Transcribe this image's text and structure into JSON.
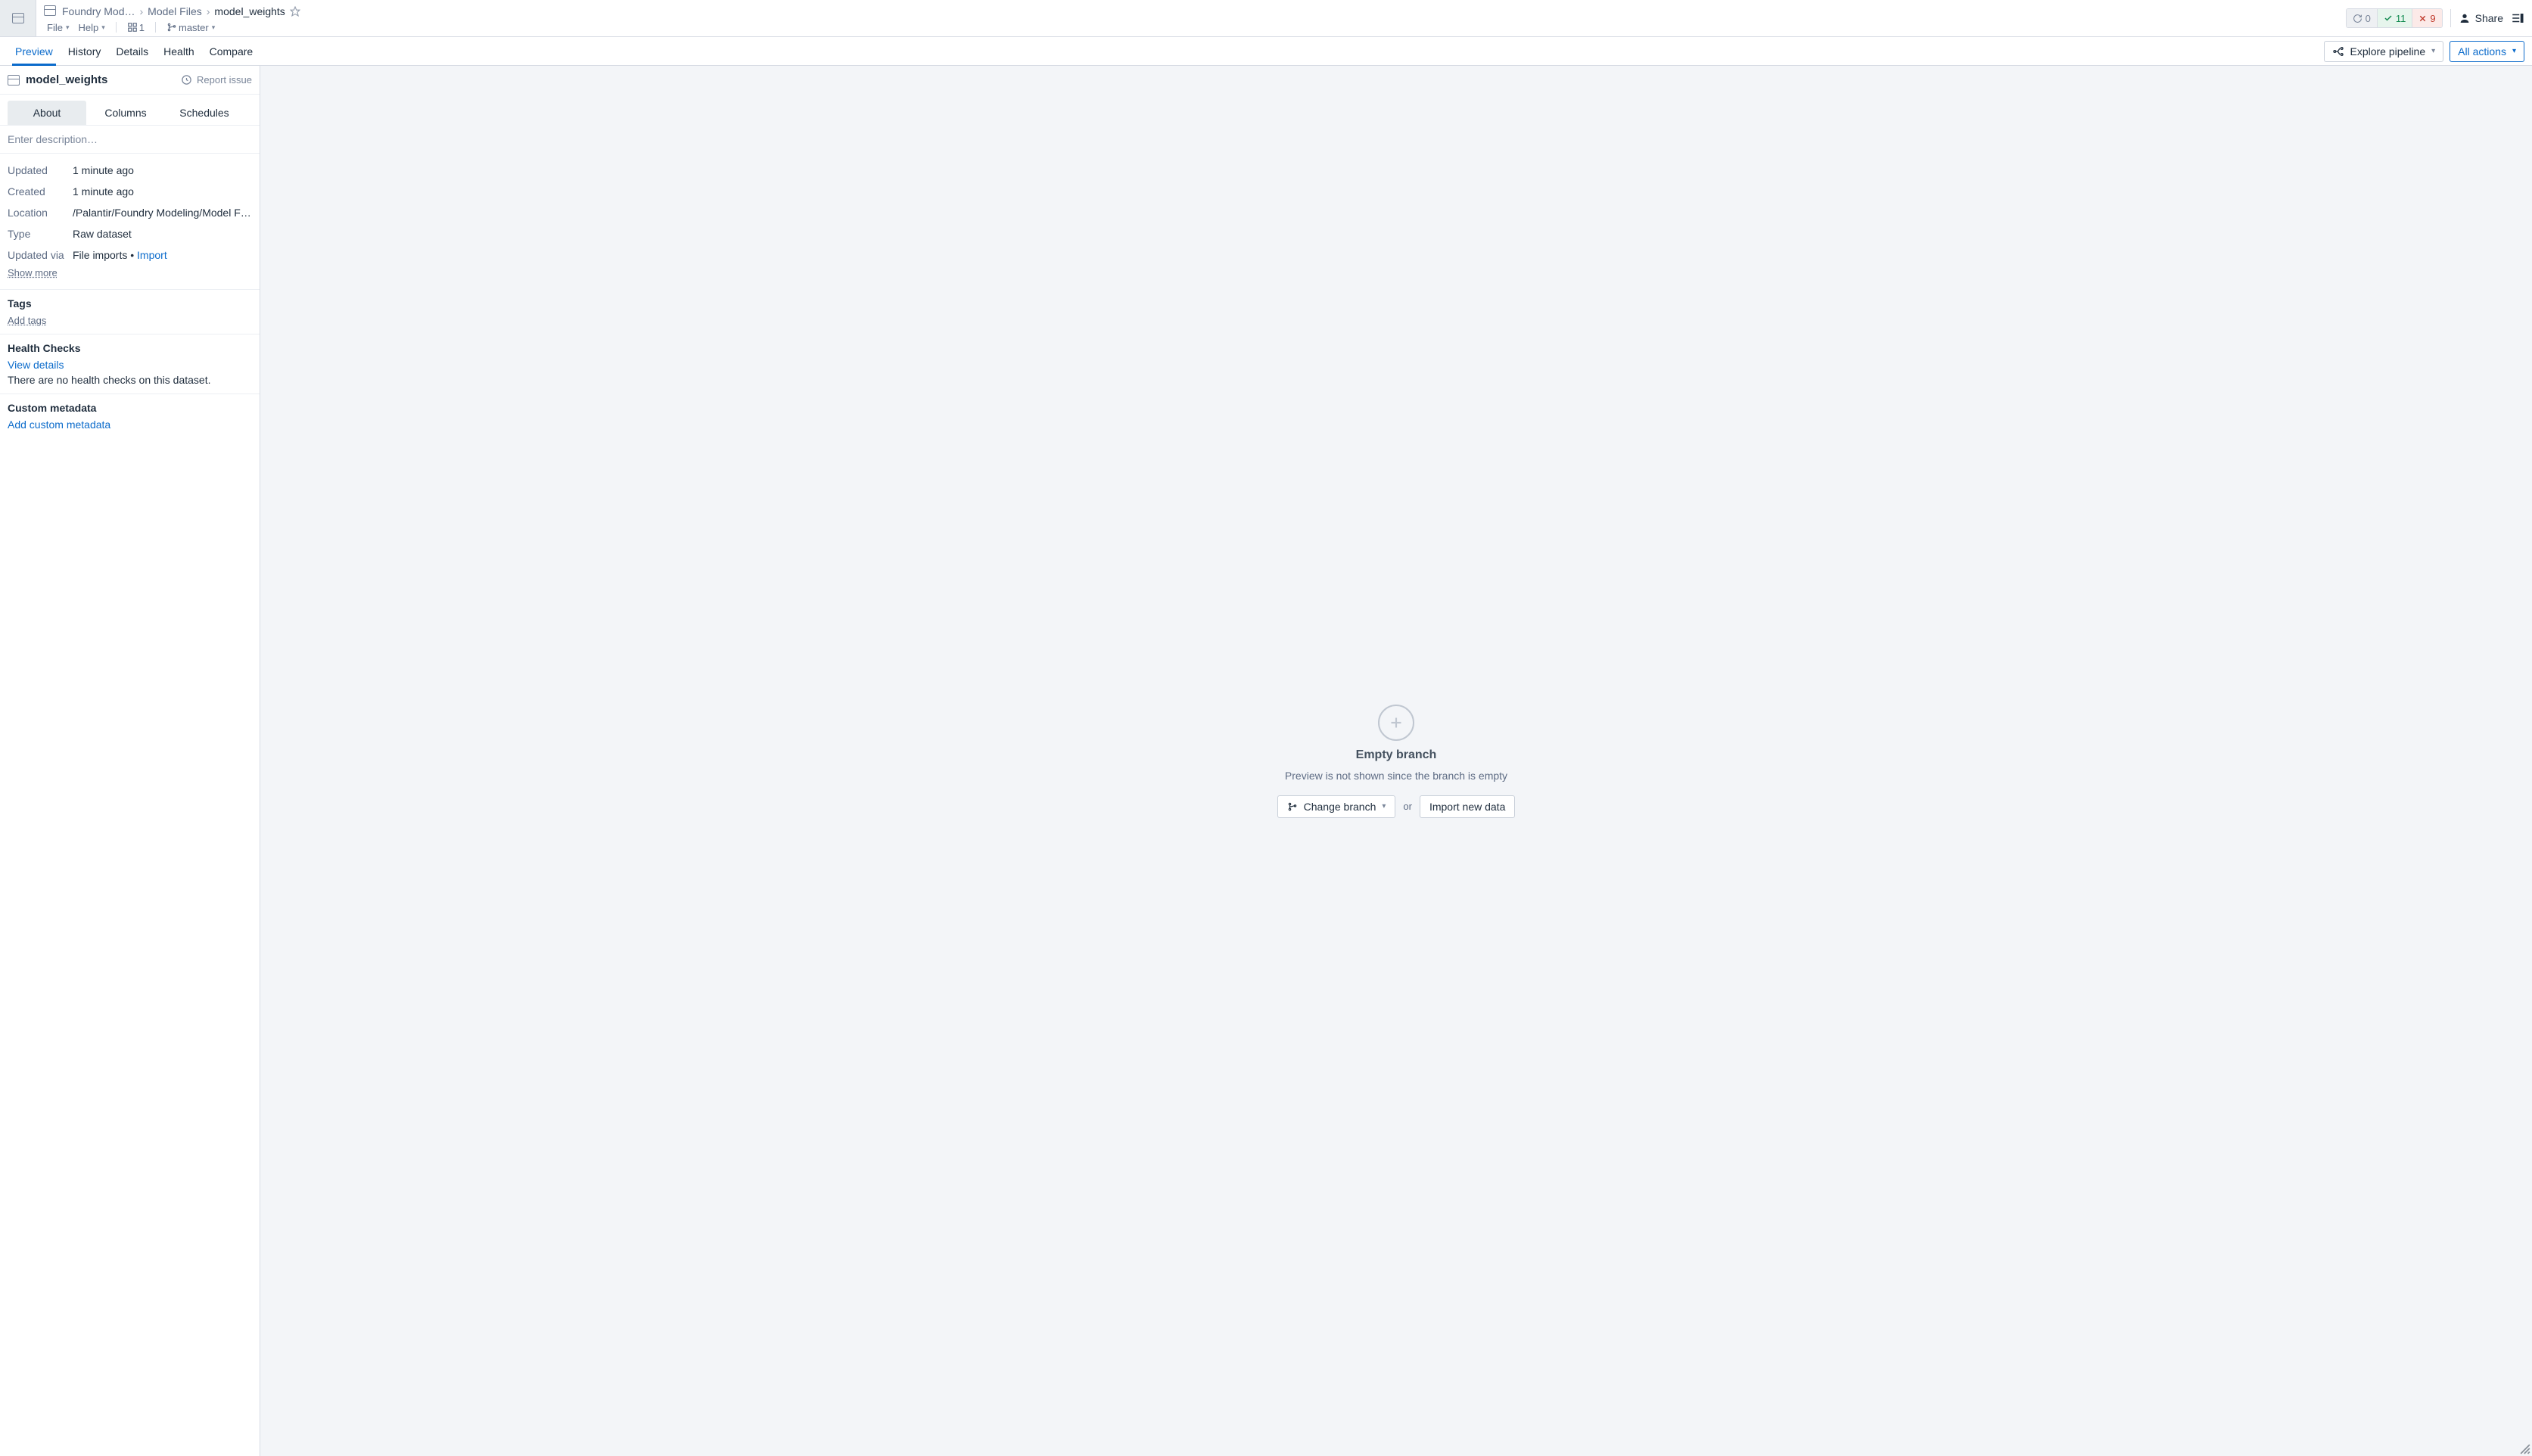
{
  "breadcrumb": {
    "items": [
      "Foundry Mod…",
      "Model Files",
      "model_weights"
    ]
  },
  "menubar": {
    "file": "File",
    "help": "Help",
    "view_count": "1",
    "branch": "master"
  },
  "status": {
    "sync": "0",
    "ok": "11",
    "err": "9"
  },
  "topbar": {
    "share": "Share"
  },
  "tabs": {
    "items": [
      "Preview",
      "History",
      "Details",
      "Health",
      "Compare"
    ],
    "explore_pipeline": "Explore pipeline",
    "all_actions": "All actions"
  },
  "sidebar": {
    "title": "model_weights",
    "report_issue": "Report issue",
    "subtabs": [
      "About",
      "Columns",
      "Schedules"
    ],
    "description_placeholder": "Enter description…",
    "meta": {
      "updated_k": "Updated",
      "updated_v": "1 minute ago",
      "created_k": "Created",
      "created_v": "1 minute ago",
      "location_k": "Location",
      "location_v": "/Palantir/Foundry Modeling/Model Files/m…",
      "type_k": "Type",
      "type_v": "Raw dataset",
      "updated_via_k": "Updated via",
      "updated_via_v": "File imports",
      "updated_via_dot": " • ",
      "updated_via_link": "Import",
      "show_more": "Show more"
    },
    "tags": {
      "heading": "Tags",
      "add": "Add tags"
    },
    "health": {
      "heading": "Health Checks",
      "view": "View details",
      "none": "There are no health checks on this dataset."
    },
    "custom": {
      "heading": "Custom metadata",
      "add": "Add custom metadata"
    }
  },
  "empty": {
    "title": "Empty branch",
    "subtitle": "Preview is not shown since the branch is empty",
    "change_branch": "Change branch",
    "or": "or",
    "import_new": "Import new data"
  }
}
